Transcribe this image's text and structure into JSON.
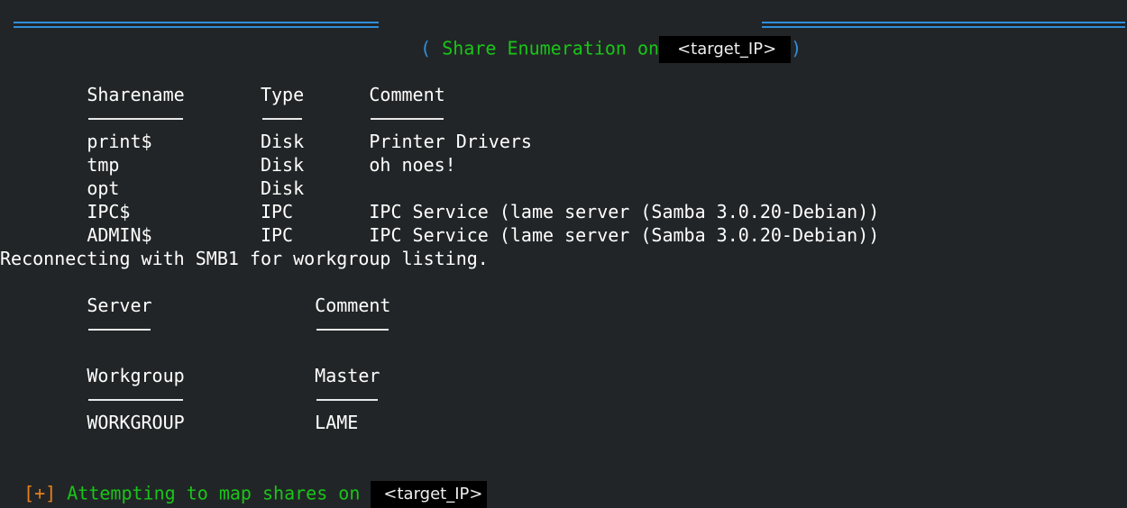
{
  "banner": {
    "open": "(",
    "title": "Share Enumeration on",
    "target": "<target_IP>",
    "close": ")",
    "rule_color": "#2f8fdc",
    "title_color": "#19c519"
  },
  "shares": {
    "headers": [
      "Sharename",
      "Type",
      "Comment"
    ],
    "rows": [
      [
        "print$",
        "Disk",
        "Printer Drivers"
      ],
      [
        "tmp",
        "Disk",
        "oh noes!"
      ],
      [
        "opt",
        "Disk",
        ""
      ],
      [
        "IPC$",
        "IPC",
        "IPC Service (lame server (Samba 3.0.20-Debian))"
      ],
      [
        "ADMIN$",
        "IPC",
        "IPC Service (lame server (Samba 3.0.20-Debian))"
      ]
    ]
  },
  "reconnect": "Reconnecting with SMB1 for workgroup listing.",
  "servers": {
    "headers": [
      "Server",
      "Comment"
    ]
  },
  "workgroups": {
    "headers": [
      "Workgroup",
      "Master"
    ],
    "rows": [
      [
        "WORKGROUP",
        "LAME"
      ]
    ]
  },
  "footer": {
    "prefix": "[+]",
    "text": "Attempting to map shares on",
    "target": "<target_IP>",
    "prefix_color": "#e8801a"
  }
}
